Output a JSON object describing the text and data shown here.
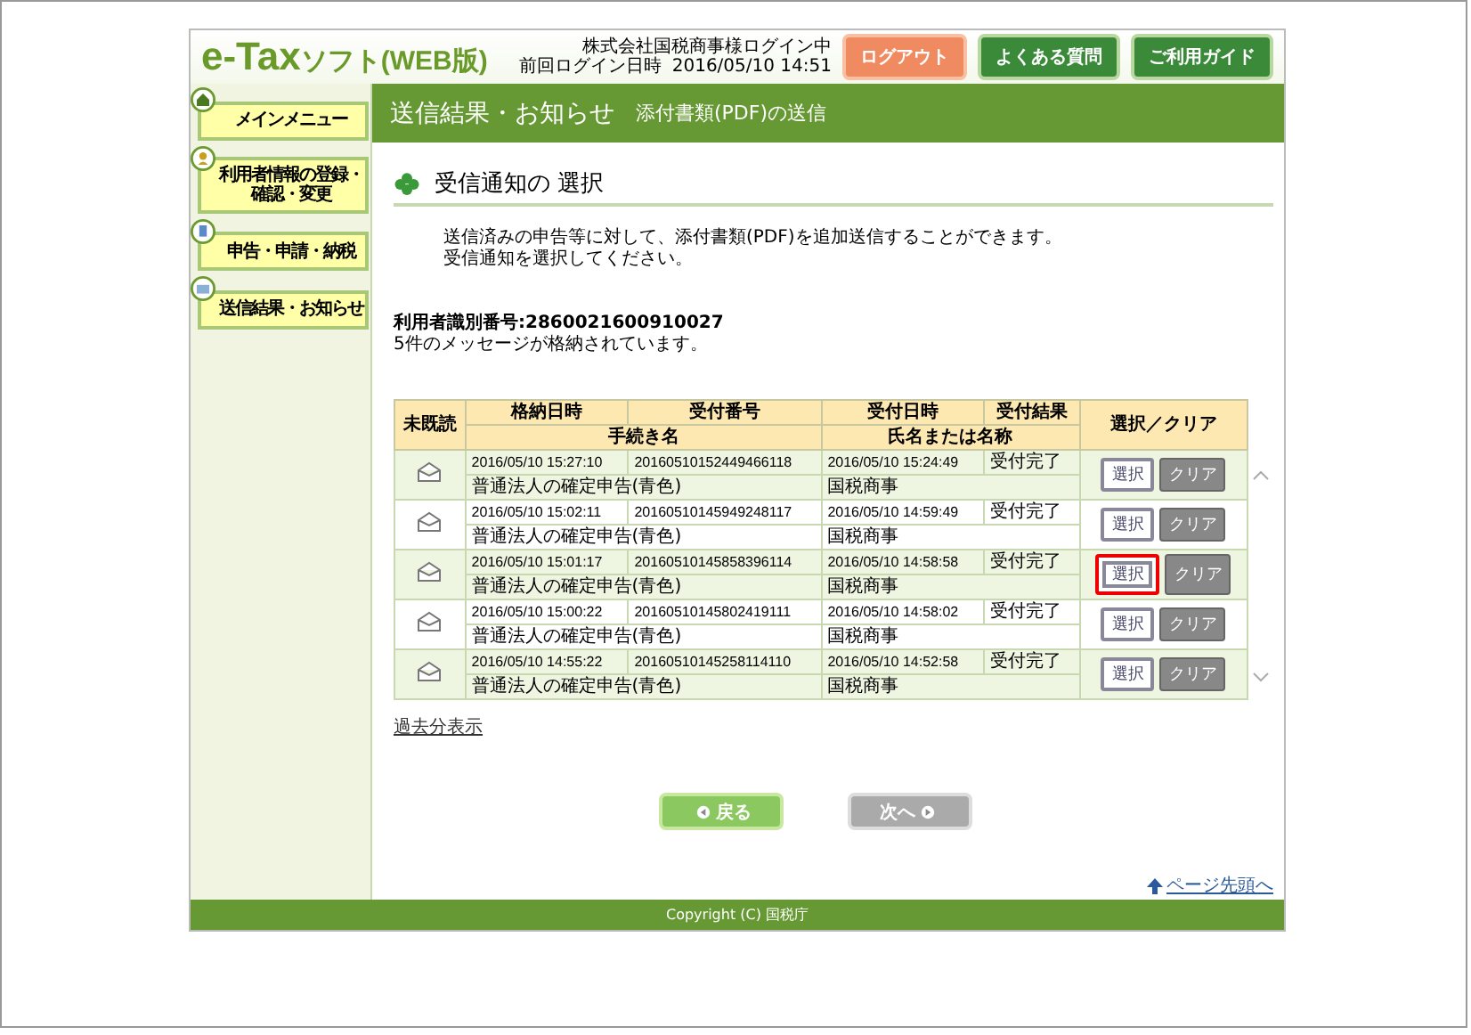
{
  "header": {
    "logo_main": "e-Tax",
    "logo_sub": "ソフト(WEB版)",
    "user_status": "株式会社国税商事様ログイン中",
    "last_login_label": "前回ログイン日時",
    "last_login": "2016/05/10 14:51",
    "buttons": [
      {
        "label": "ログアウト",
        "kind": "logout"
      },
      {
        "label": "よくある質問",
        "kind": "nav"
      },
      {
        "label": "ご利用ガイド",
        "kind": "nav"
      }
    ]
  },
  "sidebar": {
    "items": [
      {
        "label": "メインメニュー",
        "kind": "home"
      },
      {
        "label": "利用者情報の登録・確認・変更",
        "kind": "user"
      },
      {
        "label": "申告・申請・納税",
        "kind": "document"
      },
      {
        "label": "送信結果・お知らせ",
        "kind": "mail"
      }
    ]
  },
  "title_bar": {
    "section": "送信結果・お知らせ",
    "page": "添付書類(PDF)の送信"
  },
  "heading": "受信通知の 選択",
  "description": [
    "送信済みの申告等に対して、添付書類(PDF)を追加送信することができます。",
    "受信通知を選択してください。"
  ],
  "user_id": "利用者識別番号:2860021600910027",
  "message_count": "5件のメッセージが格納されています。",
  "table": {
    "header_top": [
      "未既読",
      "格納日時",
      "受付番号",
      "受付日時",
      "受付結果",
      "選択／クリア"
    ],
    "header_bottom": [
      "手続き名",
      "氏名または名称"
    ],
    "rows": [
      {
        "stored": "2016/05/10 15:27:10",
        "receipt_no": "20160510152449466118",
        "received": "2016/05/10 15:24:49",
        "result": "受付完了",
        "procedure": "普通法人の確定申告(青色)",
        "name": "国税商事",
        "select": "選択",
        "clear": "クリア",
        "highlighted": false
      },
      {
        "stored": "2016/05/10 15:02:11",
        "receipt_no": "20160510145949248117",
        "received": "2016/05/10 14:59:49",
        "result": "受付完了",
        "procedure": "普通法人の確定申告(青色)",
        "name": "国税商事",
        "select": "選択",
        "clear": "クリア",
        "highlighted": false
      },
      {
        "stored": "2016/05/10 15:01:17",
        "receipt_no": "20160510145858396114",
        "received": "2016/05/10 14:58:58",
        "result": "受付完了",
        "procedure": "普通法人の確定申告(青色)",
        "name": "国税商事",
        "select": "選択",
        "clear": "クリア",
        "highlighted": true
      },
      {
        "stored": "2016/05/10 15:00:22",
        "receipt_no": "20160510145802419111",
        "received": "2016/05/10 14:58:02",
        "result": "受付完了",
        "procedure": "普通法人の確定申告(青色)",
        "name": "国税商事",
        "select": "選択",
        "clear": "クリア",
        "highlighted": false
      },
      {
        "stored": "2016/05/10 14:55:22",
        "receipt_no": "20160510145258114110",
        "received": "2016/05/10 14:52:58",
        "result": "受付完了",
        "procedure": "普通法人の確定申告(青色)",
        "name": "国税商事",
        "select": "選択",
        "clear": "クリア",
        "highlighted": false
      }
    ]
  },
  "past_link": "過去分表示",
  "nav_buttons": [
    {
      "label": "戻る",
      "kind": "back",
      "disabled": false
    },
    {
      "label": "次へ",
      "kind": "next",
      "disabled": true
    }
  ],
  "page_top_link": "ページ先頭へ",
  "footer": "Copyright (C) 国税庁"
}
